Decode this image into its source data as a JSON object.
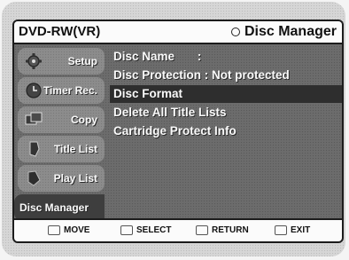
{
  "header": {
    "left_title": "DVD-RW(VR)",
    "right_title": "Disc Manager"
  },
  "sidebar": {
    "items": [
      {
        "label": "Setup",
        "icon": "gear-icon"
      },
      {
        "label": "Timer Rec.",
        "icon": "clock-icon"
      },
      {
        "label": "Copy",
        "icon": "copy-icon"
      },
      {
        "label": "Title List",
        "icon": "title-list-icon"
      },
      {
        "label": "Play List",
        "icon": "play-list-icon"
      },
      {
        "label": "Disc Manager",
        "icon": "disc-icon"
      }
    ],
    "active_index": 5
  },
  "menu": {
    "items": [
      {
        "label": "Disc Name",
        "value": ":"
      },
      {
        "label": "Disc Protection : Not protected"
      },
      {
        "label": "Disc Format"
      },
      {
        "label": "Delete All Title Lists"
      },
      {
        "label": "Cartridge Protect Info"
      }
    ],
    "selected_index": 2
  },
  "footer": {
    "move": "MOVE",
    "select": "SELECT",
    "return": "RETURN",
    "exit": "EXIT"
  }
}
